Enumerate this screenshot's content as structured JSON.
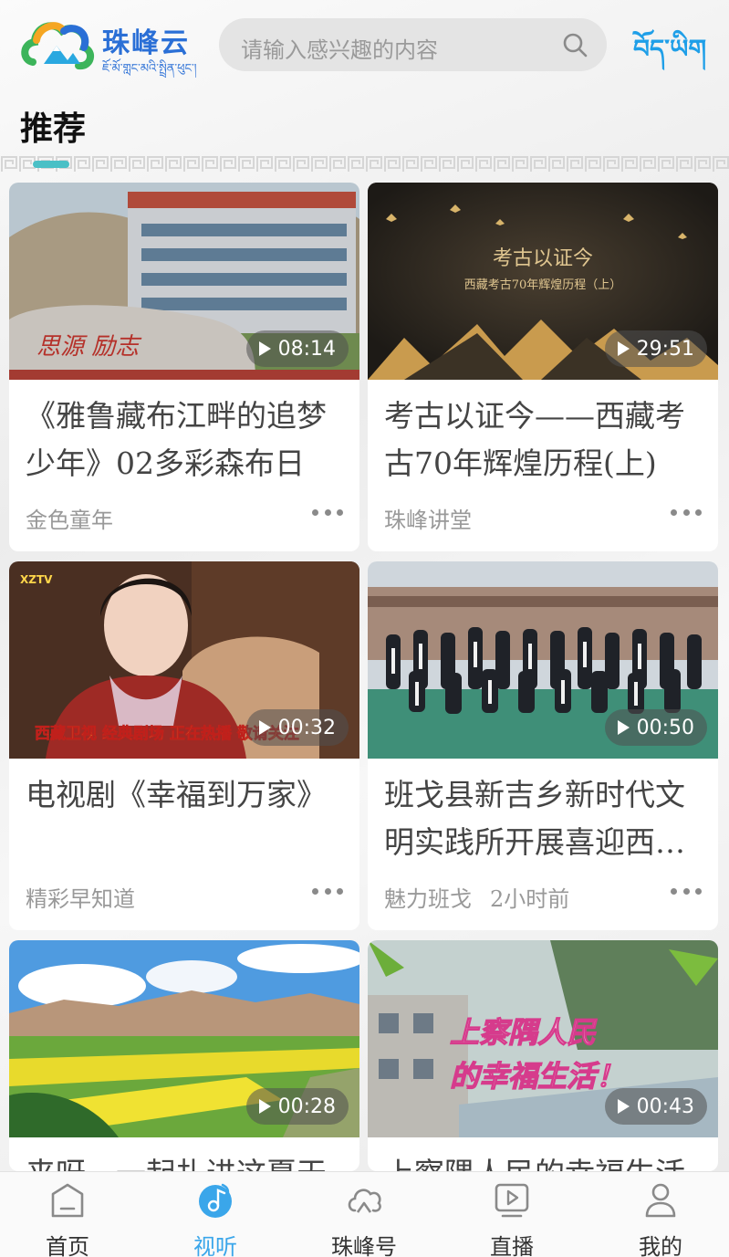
{
  "header": {
    "brand_name": "珠峰云",
    "brand_tibetan": "ཇོ་མོ་གླང་མའི་སྤྲིན་ཕུང་།",
    "search_placeholder": "请输入感兴趣的内容",
    "language_switch": "བོད་ཡིག"
  },
  "section": {
    "title": "推荐"
  },
  "cards": [
    {
      "title": "《雅鲁藏布江畔的追梦少年》02多彩森布日",
      "source": "金色童年",
      "time": "",
      "duration": "08:14"
    },
    {
      "title": "考古以证今——西藏考古70年辉煌历程(上)",
      "source": "珠峰讲堂",
      "time": "",
      "duration": "29:51"
    },
    {
      "title": "电视剧《幸福到万家》",
      "source": "精彩早知道",
      "time": "",
      "duration": "00:32"
    },
    {
      "title": "班戈县新吉乡新时代文明实践所开展喜迎西…",
      "source": "魅力班戈",
      "time": "2小时前",
      "duration": "00:50"
    },
    {
      "title": "来呀，一起扎进这夏天独",
      "source": "",
      "time": "",
      "duration": "00:28"
    },
    {
      "title": "上察隅人民的幸福生活",
      "source": "",
      "time": "",
      "duration": "00:43"
    }
  ],
  "thumb_text": {
    "school_sign": "思源 励志",
    "archaeology_title": "考古以证今",
    "archaeology_sub": "西藏考古70年辉煌历程（上）",
    "tv_logo": "XZTV",
    "tv_banner": "西藏卫视 经典剧场 正在热播 敬请关注",
    "chayu_banner_1": "上察隅人民",
    "chayu_banner_2": "的幸福生活！"
  },
  "bottom_nav": [
    {
      "label": "首页",
      "icon": "home-icon",
      "active": false
    },
    {
      "label": "视听",
      "icon": "music-note-icon",
      "active": true
    },
    {
      "label": "珠峰号",
      "icon": "cloud-mountain-icon",
      "active": false
    },
    {
      "label": "直播",
      "icon": "live-tv-icon",
      "active": false
    },
    {
      "label": "我的",
      "icon": "user-icon",
      "active": false
    }
  ],
  "colors": {
    "accent": "#3aa6ea",
    "brand": "#2a6fd6",
    "indicator": "#4ac0c6"
  }
}
